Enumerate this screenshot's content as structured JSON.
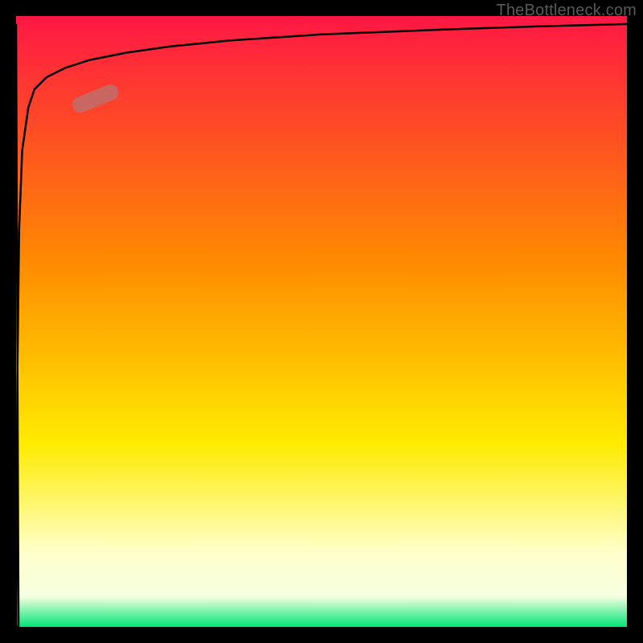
{
  "branding": "TheBottleneck.com",
  "chart_data": {
    "type": "line",
    "title": "",
    "xlabel": "",
    "ylabel": "",
    "xlim": [
      0,
      100
    ],
    "ylim": [
      0,
      100
    ],
    "gradient_stops": [
      {
        "offset": 0,
        "color": "#ff1744"
      },
      {
        "offset": 40,
        "color": "#ff8a00"
      },
      {
        "offset": 70,
        "color": "#ffeb00"
      },
      {
        "offset": 88,
        "color": "#ffffcc"
      },
      {
        "offset": 95,
        "color": "#f6ffe0"
      },
      {
        "offset": 100,
        "color": "#00e676"
      }
    ],
    "series": [
      {
        "name": "curve",
        "x": [
          0,
          0.2,
          0.5,
          1,
          2,
          3,
          5,
          8,
          12,
          18,
          25,
          35,
          50,
          70,
          85,
          100
        ],
        "values": [
          0,
          40,
          65,
          78,
          85,
          88,
          90,
          91.5,
          92.8,
          94,
          95,
          96,
          97,
          97.8,
          98.3,
          98.7
        ]
      }
    ],
    "highlight": {
      "x_center": 13,
      "y_center": 86.5,
      "angle_deg": -22
    }
  }
}
